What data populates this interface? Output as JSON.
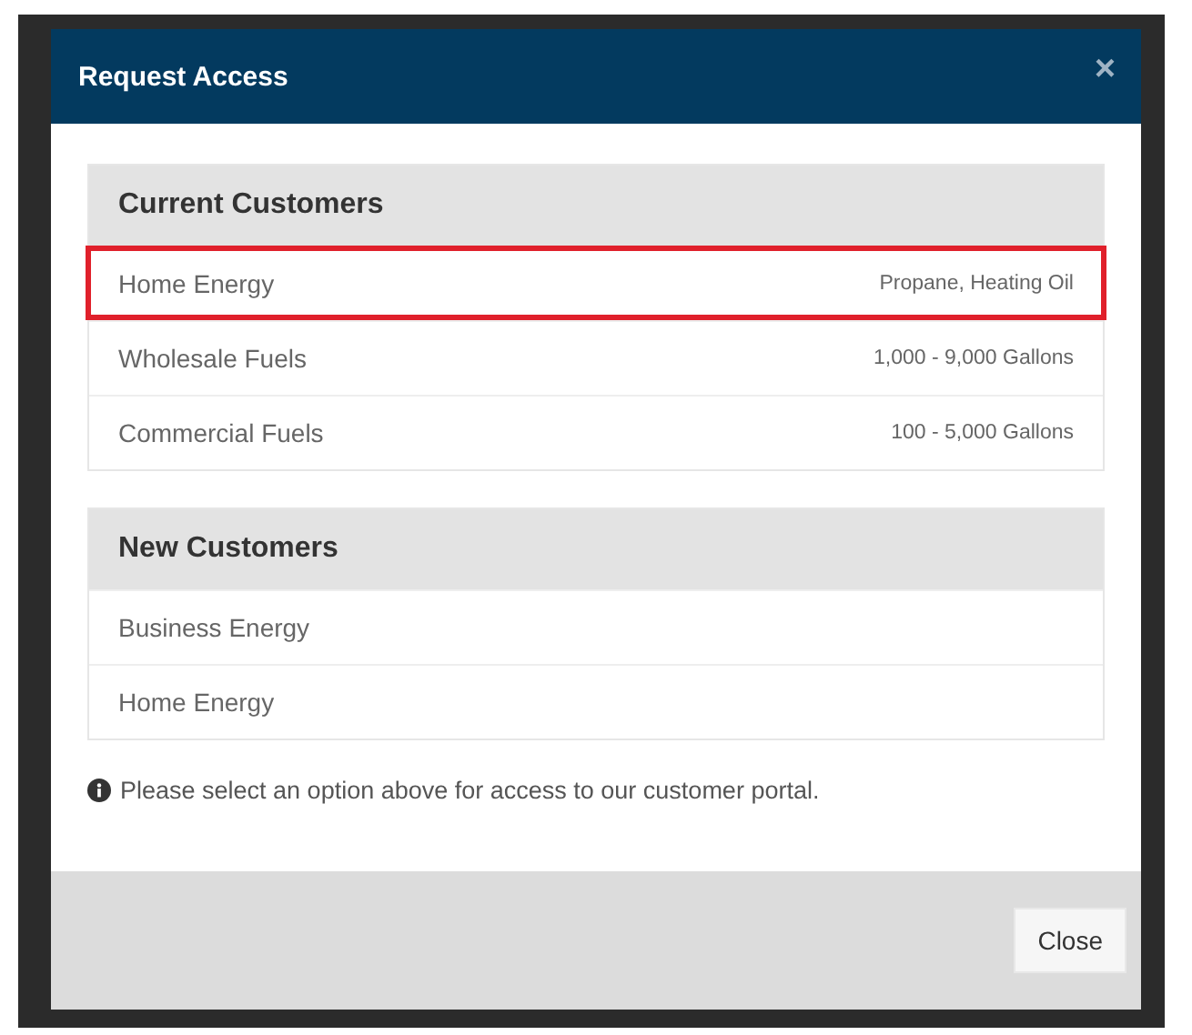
{
  "dialog": {
    "title": "Request Access",
    "close_glyph": "×"
  },
  "groups": [
    {
      "heading": "Current Customers",
      "items": [
        {
          "label": "Home Energy",
          "detail": "Propane, Heating Oil",
          "selected": true
        },
        {
          "label": "Wholesale Fuels",
          "detail": "1,000 - 9,000 Gallons",
          "selected": false
        },
        {
          "label": "Commercial Fuels",
          "detail": "100 - 5,000 Gallons",
          "selected": false
        }
      ]
    },
    {
      "heading": "New Customers",
      "items": [
        {
          "label": "Business Energy",
          "selected": false
        },
        {
          "label": "Home Energy",
          "selected": false
        }
      ]
    }
  ],
  "note": "Please select an option above for access to our customer portal.",
  "buttons": [
    "Close"
  ]
}
